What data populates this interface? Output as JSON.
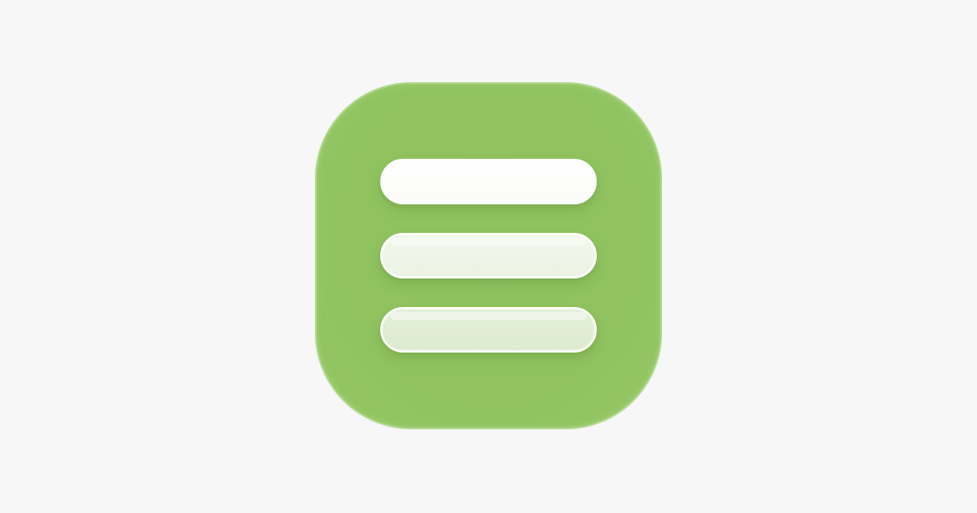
{
  "colors": {
    "background": "#f7f7f7",
    "icon_fill": "#90c360",
    "bar_top": "#ffffff",
    "bar_middle": "#eef4e7",
    "bar_bottom": "#e0edd4",
    "bar_border": "#fbfdf8"
  },
  "icon": {
    "name": "list-lines-app-icon",
    "bars": [
      {
        "name": "top-line"
      },
      {
        "name": "middle-line"
      },
      {
        "name": "bottom-line"
      }
    ]
  }
}
